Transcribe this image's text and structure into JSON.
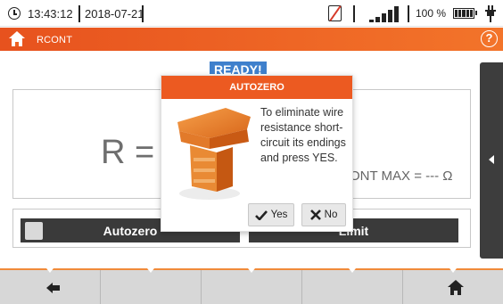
{
  "status_bar": {
    "time": "13:43:12",
    "date": "2018-07-21",
    "battery_percent": "100 %",
    "icons": [
      "clock-icon",
      "sd-card-missing-icon",
      "signal-icon",
      "battery-icon",
      "power-plug-icon"
    ]
  },
  "title_bar": {
    "title": "RCONT",
    "icons": [
      "home-icon",
      "help-icon"
    ],
    "help_label": "?"
  },
  "main": {
    "status_badge": "READY!",
    "measurement_symbol": "R =",
    "limit_text": "ONT MAX = --- Ω"
  },
  "buttons": {
    "autozero_label": "Autozero",
    "limit_label": "Limit"
  },
  "dialog": {
    "title": "AUTOZERO",
    "message": "To eliminate wire resistance short-circuit its endings and press YES.",
    "yes_label": "Yes",
    "no_label": "No"
  },
  "bottom_bar": {
    "icons": [
      "back-arrow-icon",
      "home-icon"
    ]
  },
  "colors": {
    "accent": "#ec5a21",
    "ready_badge": "#3f80cc",
    "dark_button": "#3a3a3a"
  }
}
